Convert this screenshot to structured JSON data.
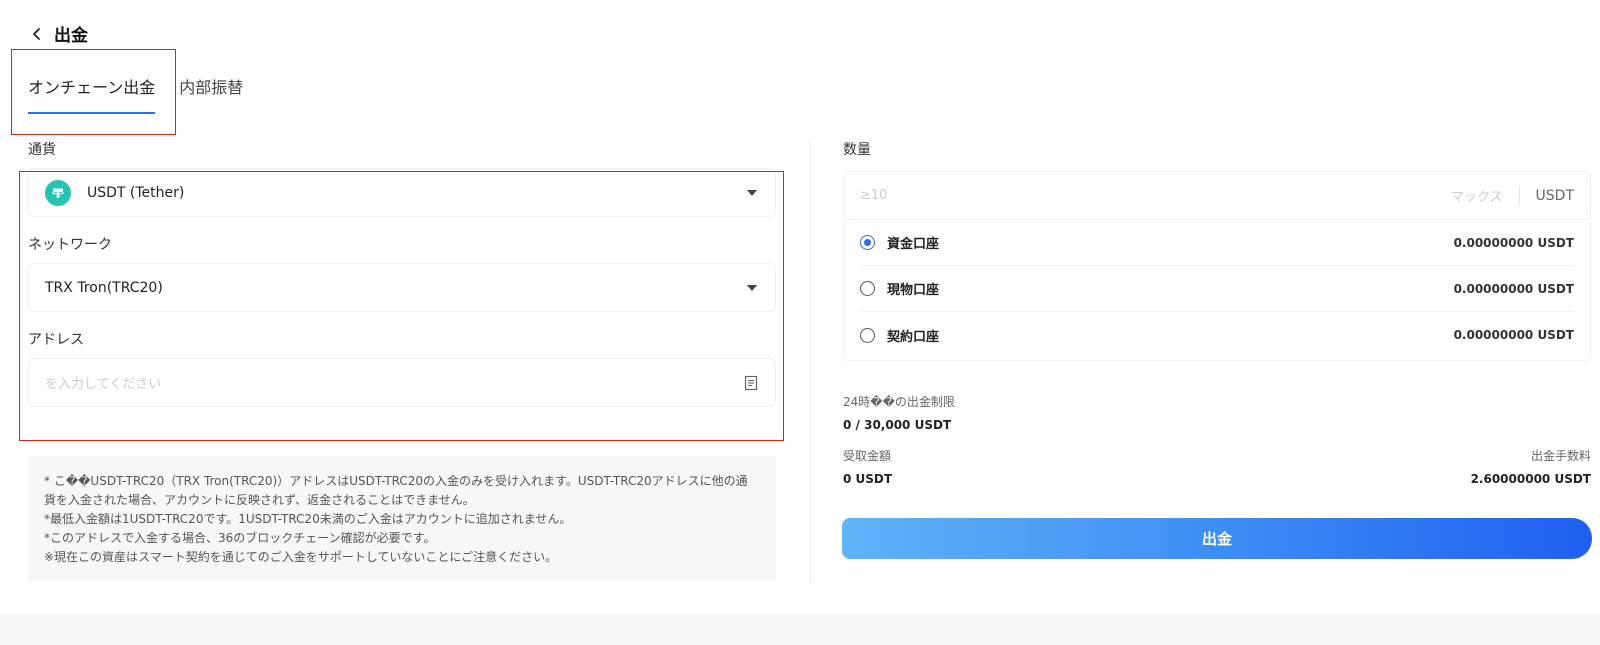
{
  "header": {
    "title": "出金",
    "back_icon": "chevron-left-icon"
  },
  "tabs": [
    {
      "label": "オンチェーン出金",
      "active": true
    },
    {
      "label": "内部振替",
      "active": false
    }
  ],
  "form": {
    "currency_label": "通貨",
    "currency_value": "USDT (Tether)",
    "currency_icon": "tether-icon",
    "network_label": "ネットワーク",
    "network_value": "TRX Tron(TRC20)",
    "address_label": "アドレス",
    "address_placeholder": "を入力してください",
    "address_icon": "clipboard-icon"
  },
  "notice": {
    "lines": [
      "* こ��USDT-TRC20（TRX Tron(TRC20)）アドレスはUSDT-TRC20の入金のみを受け入れます。USDT-TRC20アドレスに他の通",
      "貨を入金された場合、アカウントに反映されず、返金されることはできません。",
      "*最低入金額は1USDT-TRC20です。1USDT-TRC20未満のご入金はアカウントに追加されません。",
      "*このアドレスで入金する場合、36のブロックチェーン確認が必要です。",
      "※現在この資産はスマート契約を通じてのご入金をサポートしていないことにご注意ください。"
    ]
  },
  "amount": {
    "label": "数量",
    "placeholder": "≥10",
    "max_label": "マックス",
    "unit": "USDT"
  },
  "accounts": [
    {
      "name": "資金口座",
      "balance": "0.00000000 USDT",
      "selected": true
    },
    {
      "name": "現物口座",
      "balance": "0.00000000 USDT",
      "selected": false
    },
    {
      "name": "契約口座",
      "balance": "0.00000000 USDT",
      "selected": false
    }
  ],
  "limits": {
    "daily_label": "24時��の出金制限",
    "daily_value": "0 / 30,000 USDT",
    "receive_label": "受取金額",
    "receive_value": "0 USDT",
    "fee_label": "出金手数料",
    "fee_value": "2.60000000 USDT"
  },
  "submit_label": "出金",
  "colors": {
    "accent": "#2f6fe0",
    "highlight": "#e02020",
    "coin": "#26c4b0"
  }
}
